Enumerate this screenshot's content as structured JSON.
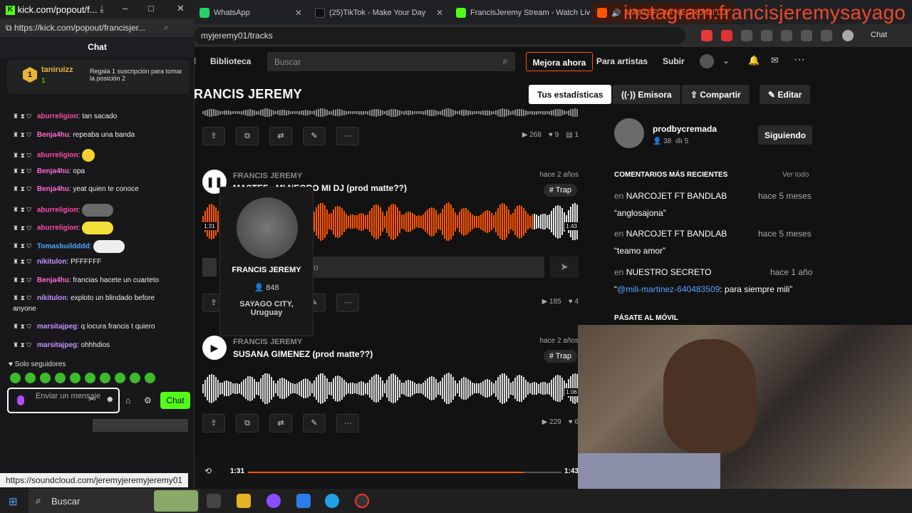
{
  "browser": {
    "tabs": [
      {
        "label": "WhatsApp",
        "color": "#25d366"
      },
      {
        "label": "(25)TikTok - Make Your Day",
        "color": "#ffffff"
      },
      {
        "label": "FrancisJeremy Stream - Watch Live",
        "color": "#53fc18"
      },
      {
        "label": "MASTEF · MI NEGRO MI DJ",
        "color": "#ff5500"
      }
    ],
    "address": "myjeremy01/tracks",
    "copilot_label": "Chat"
  },
  "overlay": {
    "text": "instagram:francisjeremysayago"
  },
  "kick": {
    "window_title": "kick.com/popout/f...",
    "address": "https://kick.com/popout/francisjer...",
    "chat_title": "Chat",
    "pinned": {
      "rank": "1",
      "user": "taniruizz",
      "count": "1",
      "text": "Regala 1 suscripción para tomar la posición 2"
    },
    "messages": [
      {
        "user": "aburreligion",
        "text": ": tan sacado",
        "color": "#ff4da6"
      },
      {
        "user": "Benja4hu",
        "text": ": repeaba una banda",
        "color": "#ff6ad5"
      },
      {
        "user": "aburreligion",
        "text": ":",
        "color": "#ff4da6",
        "emote": "yellow-face"
      },
      {
        "user": "Benja4hu",
        "text": ": opa",
        "color": "#ff6ad5"
      },
      {
        "user": "Benja4hu",
        "text": ": yeat quien te conoce",
        "color": "#ff6ad5"
      },
      {
        "user": "aburreligion",
        "text": ":",
        "color": "#ff4da6",
        "emote": "photo"
      },
      {
        "user": "aburreligion",
        "text": ":",
        "color": "#ff4da6",
        "emote": "car"
      },
      {
        "user": "Tomasbuildddd",
        "text": ":",
        "color": "#4da3ff",
        "emote": "ghost"
      },
      {
        "user": "nikitulon",
        "text": ": PFFFFFF",
        "color": "#c792ff"
      },
      {
        "user": "Benja4hu",
        "text": ": francias hacete un cuarteto",
        "color": "#ff6ad5"
      },
      {
        "user": "nikitulon",
        "text": ": exploto un blindado before",
        "color": "#c792ff",
        "wrap": "anyone"
      },
      {
        "user": "marsitajpeg",
        "text": ": q locura francis t quiero",
        "color": "#c792ff"
      },
      {
        "user": "marsitajpeg",
        "text": ": ohhhdios",
        "color": "#c792ff"
      }
    ],
    "followers_only": "Solo seguidores",
    "input_placeholder": "Enviar un mensaje",
    "send_label": "Chat"
  },
  "soundcloud": {
    "nav": {
      "library": "Biblioteca",
      "search_placeholder": "Buscar",
      "premium": "Mejora ahora",
      "artists": "Para artistas",
      "upload": "Subir"
    },
    "profile_title": "RANCIS JEREMY",
    "header_buttons": {
      "stats": "Tus estadísticas",
      "station": "Emisora",
      "share": "Compartir",
      "edit": "Editar"
    },
    "tracks": [
      {
        "stats": {
          "plays": "268",
          "likes": "9",
          "comments": "1"
        }
      },
      {
        "artist": "FRANCIS JEREMY",
        "title": "MASTEF · MI NEGRO MI DJ (prod matte??)",
        "ago": "hace 2 años",
        "tag": "# Trap",
        "elapsed": "1:31",
        "duration": "1:43",
        "progress": 0.88,
        "comment_placeholder": "o",
        "stats": {
          "plays": "185",
          "likes": "4"
        }
      },
      {
        "artist": "FRANCIS JEREMY",
        "title": "SUSANA GIMENEZ (prod matte??)",
        "ago": "hace 2 años",
        "tag": "# Trap",
        "duration": "1:06",
        "stats": {
          "plays": "229",
          "likes": "6"
        }
      }
    ],
    "popup": {
      "name": "FRANCIS JEREMY",
      "followers": "848",
      "location": "SAYAGO CITY, Uruguay"
    },
    "sidebar": {
      "following_user": "prodbycremada",
      "following_followers": "38",
      "following_tracks": "5",
      "following_label": "Siguiendo",
      "recent_comments_title": "COMENTARIOS MÁS RECIENTES",
      "see_all": "Ver todo",
      "comments": [
        {
          "prefix": "en",
          "track": "NARCOJET FT BANDLAB",
          "ago": "hace 5 meses",
          "text": "“anglosajona”"
        },
        {
          "prefix": "en",
          "track": "NARCOJET FT BANDLAB",
          "ago": "hace 5 meses",
          "text": "“teamo amor”"
        },
        {
          "prefix": "en",
          "track": "NUESTRO SECRETO",
          "ago": "hace 1 año",
          "mention": "@mili-martinez-640483509",
          "text": ": para siempre mili”",
          "open": "“"
        }
      ],
      "mobile_title": "PÁSATE AL MÓVIL"
    },
    "player": {
      "elapsed": "1:31",
      "duration": "1:43",
      "progress": 0.88
    }
  },
  "status_url": "https://soundcloud.com/jeremyjeremyjeremy01",
  "taskbar": {
    "search": "Buscar"
  }
}
